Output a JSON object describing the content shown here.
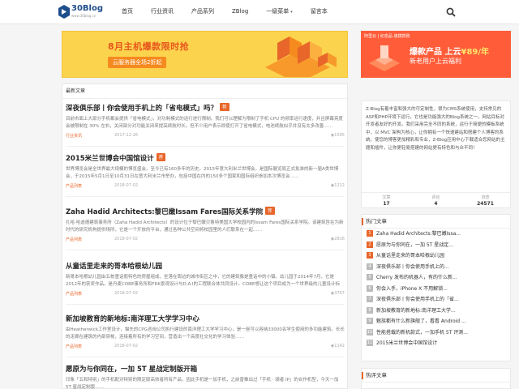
{
  "logo": {
    "name": "30Blog",
    "sub": "www.30blog.cn"
  },
  "nav": {
    "items": [
      "首页",
      "行业资讯",
      "产品系列",
      "ZBlog",
      "一级菜单",
      "留言本"
    ],
    "dropdown_caret": "▾"
  },
  "banner": {
    "title": "8月主机爆款限时抢",
    "subtitle": "云服务器全场2折起"
  },
  "list": {
    "heading": "最新文章",
    "articles": [
      {
        "title": "深夜俱乐部丨你会使用手机上的「省电模式」吗？",
        "tag": "荐",
        "excerpt": "目前市面上大部分手机都会提供「省电模式」，对功耗模式的运行进行限制。我们可以理解为限制了手机 CPU 的频率运行速度，并且屏幕亮度会被限制在 30% 左右，关闭部分对功能关闭来提高续航时长。但不少用户表示即使打开了省电模式，电池续航似乎并没有太多改善……",
        "category": "行业资讯",
        "date": "2017-12-26",
        "views": "1595"
      },
      {
        "title": "2015米兰世博会中国馆设计",
        "tag": "荐",
        "excerpt": "世界博览会是全世界最大规模的博览盛会，至今已有160多年的历史。2015年意大利米兰世博会，是国际展览局正式批准的新一届A类世博会，于2015年5月1日至10月31日在意大利米兰市举办，包括中国在内的150多个国家和国际组织参加本次博览会……",
        "category": "产品列表",
        "date": "2018-07-02",
        "views": "1212"
      },
      {
        "title": "Zaha Hadid Architects:黎巴嫩Issam Fares国际关系学院",
        "tag": "荐",
        "excerpt": "扎哈·哈迪德建筑事务所（Zaha Hadid Architects）的设计位于黎巴嫩贝鲁特美国大学校园内的Issam Fares国际关系学院。该建筑旨在为新时代的研究机构提供场所，它是一个开放的平台，通过各种公共空间将校园里的人们联系在一起……",
        "category": "产品列表",
        "date": "2018-07-02",
        "views": "2816"
      },
      {
        "title": "从童话里走来的哥本哈根幼儿园",
        "tag": "",
        "excerpt": "新哥本哈根幼儿园由五栋童话般特色的房屋组成，坐落在周边的城市街区之中，它的建筑像是童话中的小镇。幼儿园于2014年7月，它是2012年的获奖作品。是丹麦COBE事务所和FRK景观设计与D.A.I的工程联合体共同设计。COBE想让这个项目成为一个世界级的儿童设计标准……",
        "category": "产品列表",
        "date": "2018-07-02",
        "views": "3767"
      },
      {
        "title": "新加坡教育的新地标:南洋理工大学学习中心",
        "tag": "",
        "excerpt": "由Heatherwick工作室设计，猫先的CPG咨询公司执行建设的南洋理工大学学习中心，是一座可以容纳33000名学生使用的多功能建筑。长长的走廊在建筑的内部穿梭，连接着所有的学习空间，营造出一个高度社交化的学习体验……",
        "category": "产品列表",
        "date": "2018-07-02",
        "views": "1142"
      },
      {
        "title": "愿原为与你同在，一加 5T 星战定制版开箱",
        "tag": "",
        "excerpt": "印象「五和特别」的手机配对特别的限定版高效者所有产品，因此手机是一加手机，之前曾推出过「手机 · 骑者 IP」的合作机型，今天一加 5T 星战定制版……",
        "category": "",
        "date": "",
        "views": ""
      }
    ]
  },
  "ad": {
    "top": "阿里云 | 纪念品·速拨款购",
    "line1_a": "爆款产品 上云",
    "line1_price": "¥89/年",
    "line2": "新老用户上云福利"
  },
  "about": {
    "text": "Z-Blog有着丰富和强大的可定制性，很为CMS系统使用，支持常见的 ASP和PHP环境下运行，它也是功能强大的Blog系统之一，网站目标对开发者友好的开发。我们采用完全不同的系统，运行于简便的模板系统中，以 MVC 架构为核心，让你拥有一个快速建站和搭建个人博客的系统。使您的博客更加精彩和专业，Z-Blog应用中心下载适合您网站的主题和插件，让你更轻易搭建的网站更有特色和与众不同！",
    "stats": [
      {
        "label": "文章",
        "value": "17"
      },
      {
        "label": "评论",
        "value": "4"
      },
      {
        "label": "浏览",
        "value": "24571"
      }
    ]
  },
  "hot": {
    "heading": "热门文章",
    "items": [
      "Zaha Hadid Architects:黎巴嫩Issa...",
      "愿原为与你同在，一加 5T 星战定...",
      "从童话里走来的哥本哈根幼儿园",
      "深夜俱乐部丨你会使用手机上的...",
      "Cherry 发布的机器人，有的什么新...",
      "你会入手，iPhone X 不用解锁...",
      "深夜俱乐部丨你会使用手机上的「省...",
      "新加坡教育的新地标:南洋理工大学...",
      "魅族都有什么新旗舰了，看看 Android ...",
      "性能搭载的新机款式，一加手机 5T 评测...",
      "2015米兰世博会中国馆设计"
    ]
  },
  "hot2": {
    "heading": "热评文章"
  },
  "colors": {
    "accent": "#e8662a",
    "brand": "#1e4e8c",
    "banner": "#fcd34d",
    "ad": "#ff5d3a"
  }
}
